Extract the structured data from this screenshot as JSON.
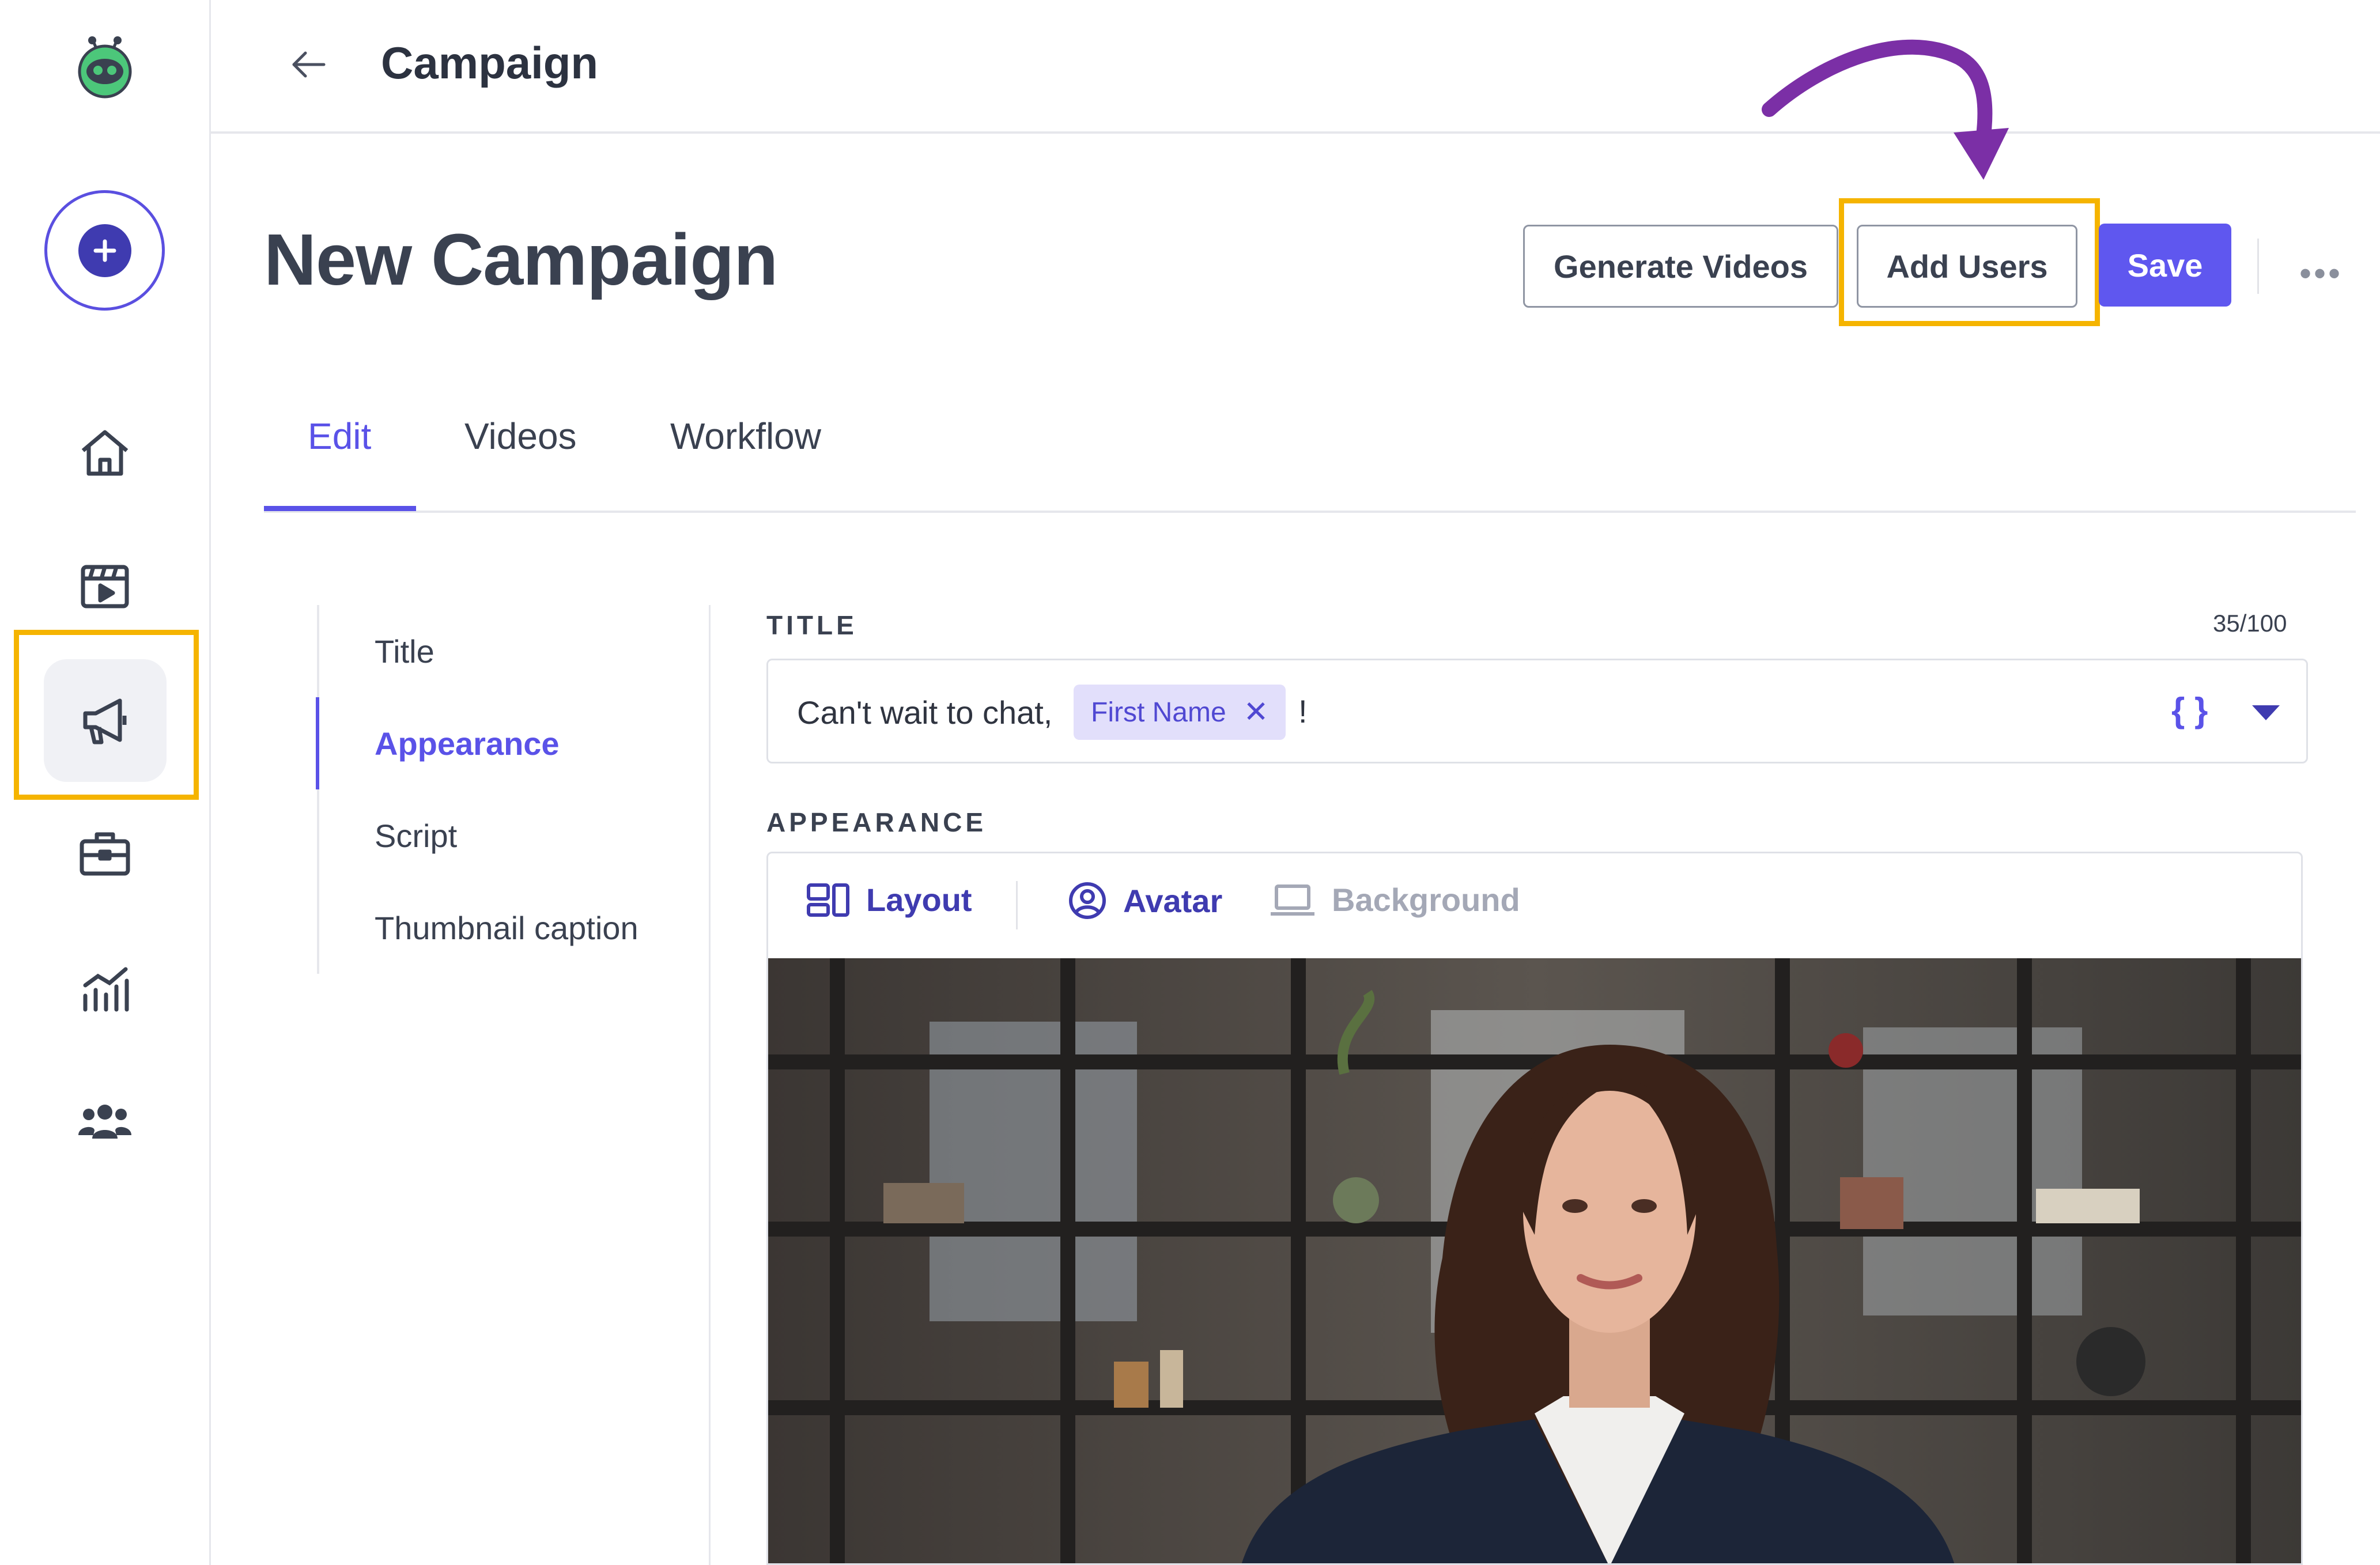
{
  "header": {
    "title": "Campaign"
  },
  "page": {
    "title": "New Campaign"
  },
  "actions": {
    "generate_label": "Generate Videos",
    "add_users_label": "Add Users",
    "save_label": "Save",
    "more_label": "•••"
  },
  "tabs": [
    {
      "label": "Edit"
    },
    {
      "label": "Videos"
    },
    {
      "label": "Workflow"
    }
  ],
  "sections": [
    {
      "label": "Title"
    },
    {
      "label": "Appearance"
    },
    {
      "label": "Script"
    },
    {
      "label": "Thumbnail caption"
    }
  ],
  "title_field": {
    "label": "TITLE",
    "counter": "35/100",
    "text": "Can't wait to chat,",
    "token": "First Name",
    "token_remove": "✕",
    "suffix": "!",
    "variables_icon": "{ }"
  },
  "appearance": {
    "label": "APPEARANCE",
    "subtabs": [
      {
        "label": "Layout"
      },
      {
        "label": "Avatar"
      },
      {
        "label": "Background"
      }
    ]
  },
  "sidebar": {
    "items": [
      {
        "icon": "home-icon"
      },
      {
        "icon": "video-library-icon"
      },
      {
        "icon": "megaphone-icon"
      },
      {
        "icon": "briefcase-icon"
      },
      {
        "icon": "analytics-icon"
      },
      {
        "icon": "team-icon"
      }
    ]
  },
  "colors": {
    "accent": "#5f57ef",
    "highlight": "#f5b400",
    "annotation_arrow": "#7b2fa6",
    "token_bg": "#e2dffb"
  }
}
